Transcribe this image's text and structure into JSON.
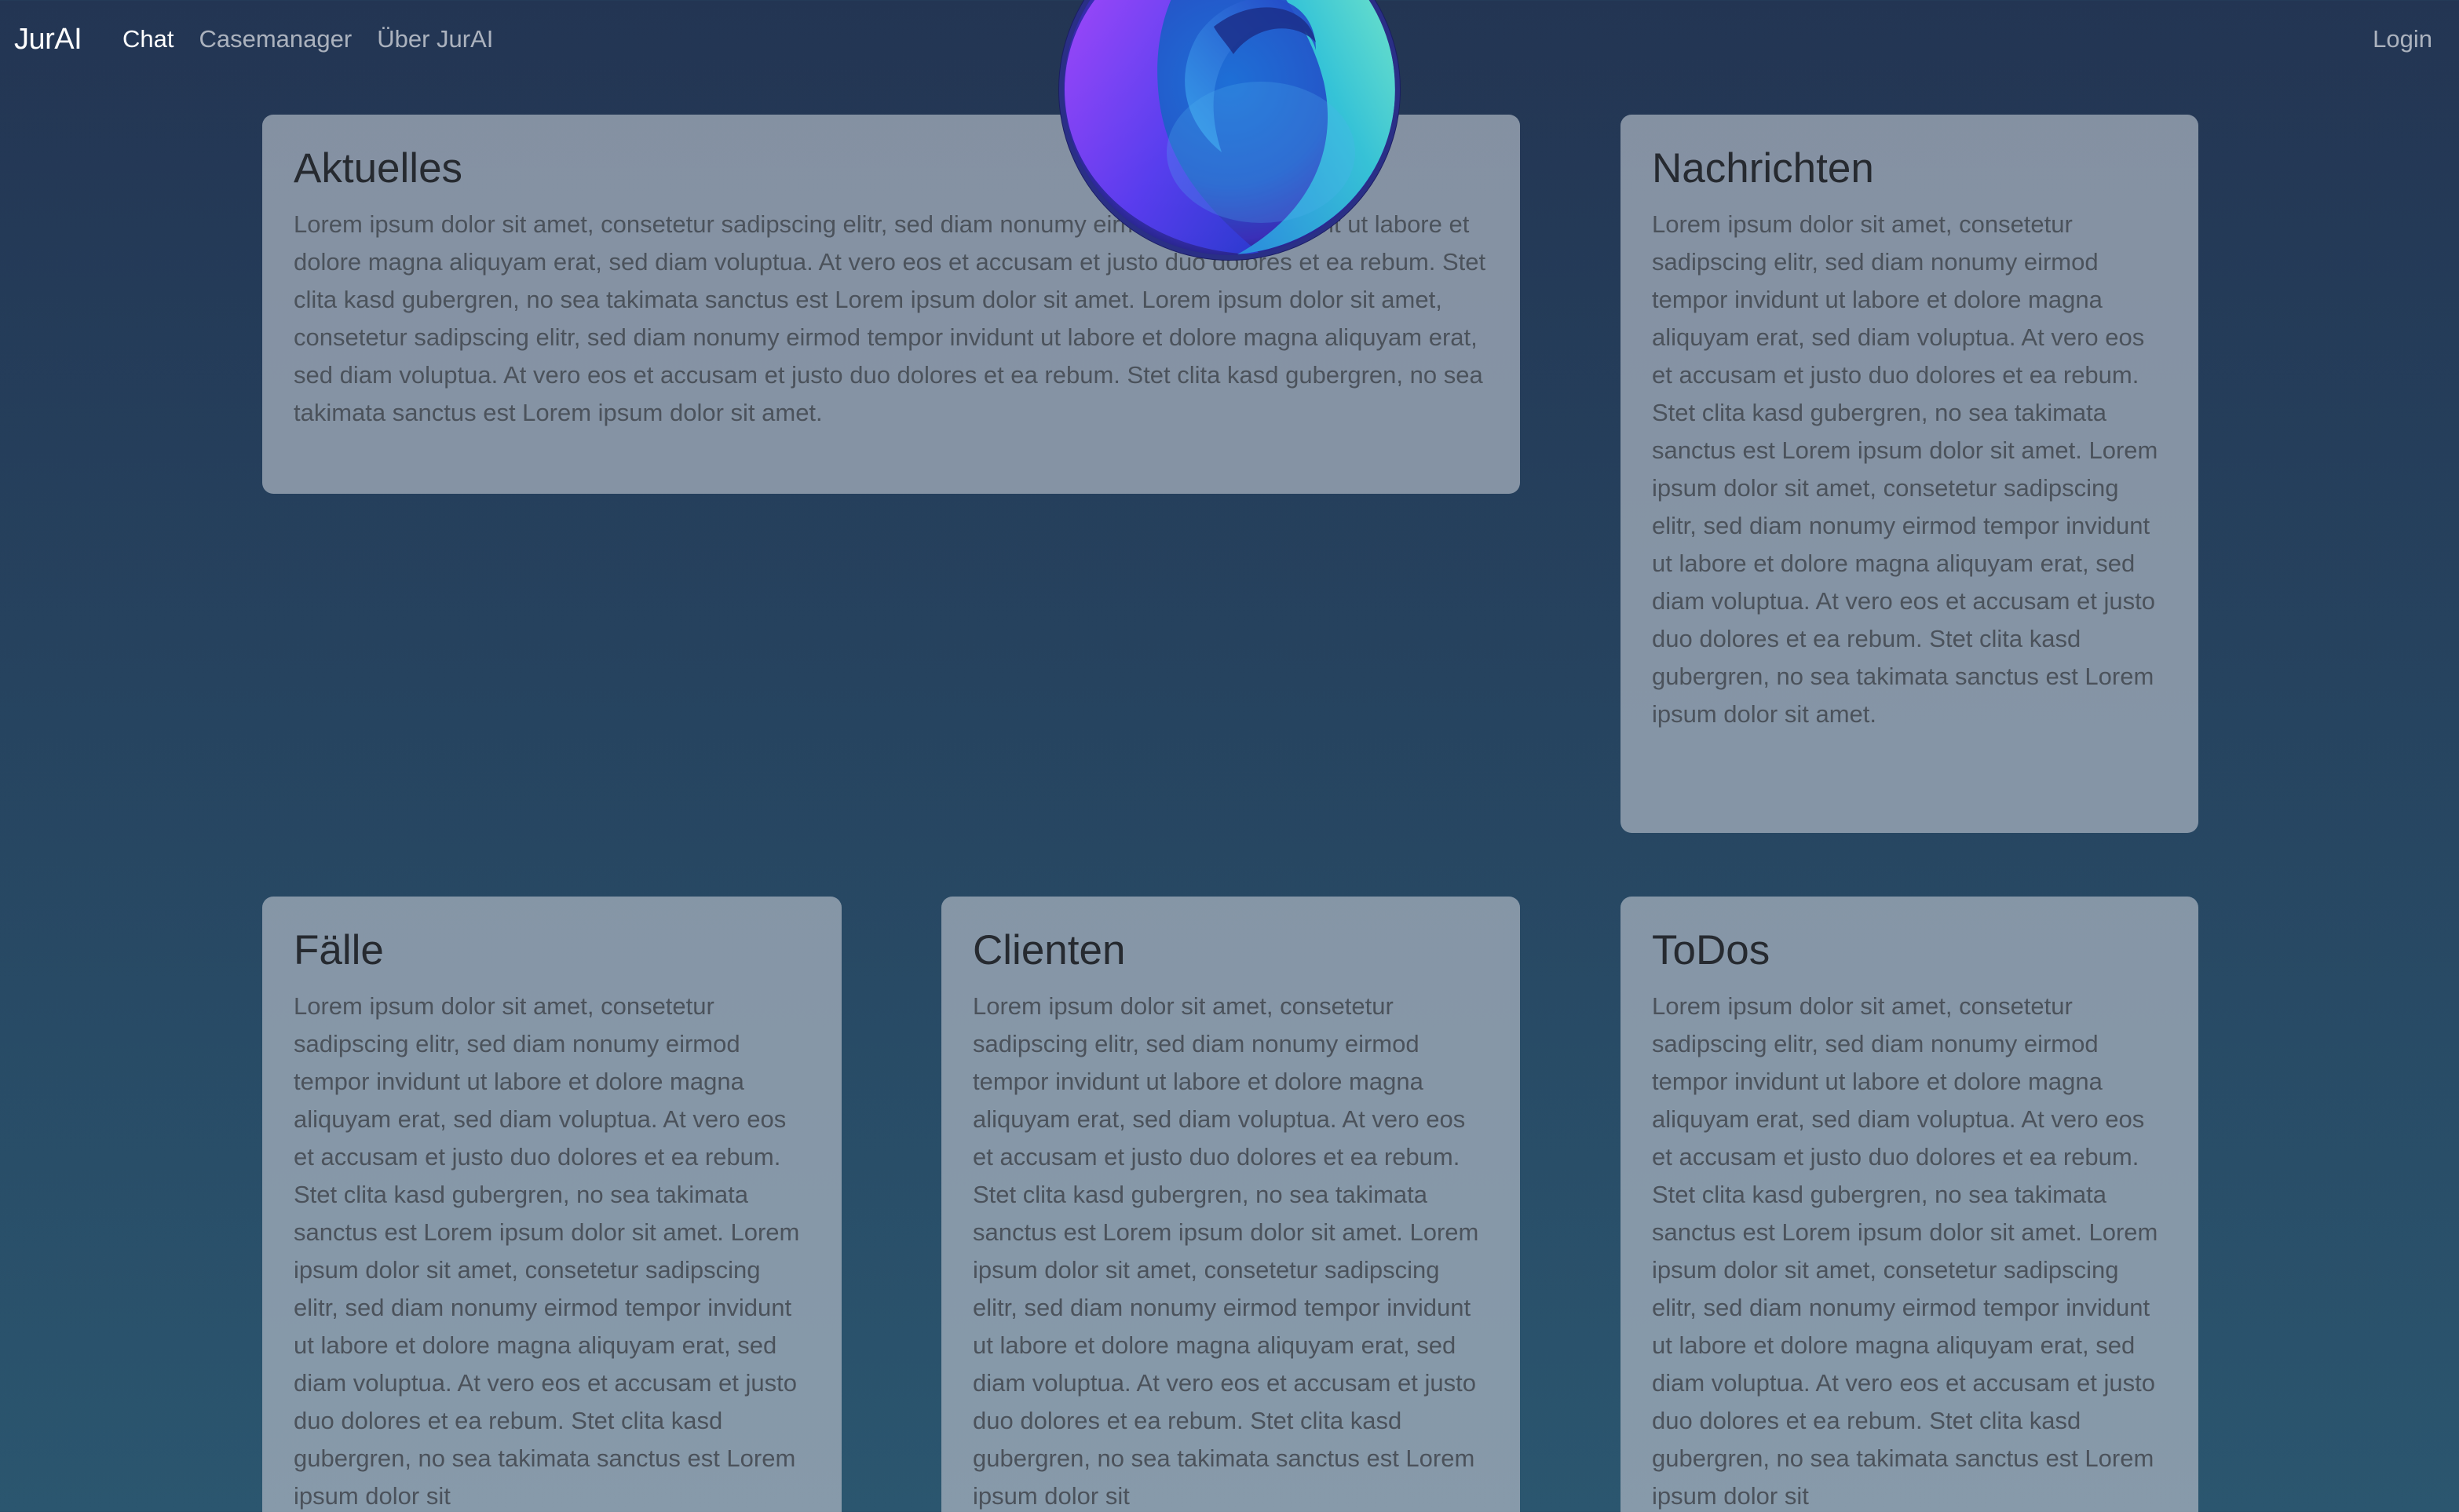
{
  "nav": {
    "brand": "JurAI",
    "links": [
      {
        "label": "Chat",
        "active": true
      },
      {
        "label": "Casemanager",
        "active": false
      },
      {
        "label": "Über JurAI",
        "active": false
      }
    ],
    "login": "Login"
  },
  "logo": {
    "icon": "orb-logo-icon"
  },
  "cards": {
    "aktuelles": {
      "title": "Aktuelles",
      "text": "Lorem ipsum dolor sit amet, consetetur sadipscing elitr, sed diam nonumy eirmod tempor invidunt ut labore et dolore magna aliquyam erat, sed diam voluptua. At vero eos et accusam et justo duo dolores et ea rebum. Stet clita kasd gubergren, no sea takimata sanctus est Lorem ipsum dolor sit amet. Lorem ipsum dolor sit amet, consetetur sadipscing elitr, sed diam nonumy eirmod tempor invidunt ut labore et dolore magna aliquyam erat, sed diam voluptua. At vero eos et accusam et justo duo dolores et ea rebum. Stet clita kasd gubergren, no sea takimata sanctus est Lorem ipsum dolor sit amet."
    },
    "nachrichten": {
      "title": "Nachrichten",
      "text": "Lorem ipsum dolor sit amet, consetetur sadipscing elitr, sed diam nonumy eirmod tempor invidunt ut labore et dolore magna aliquyam erat, sed diam voluptua. At vero eos et accusam et justo duo dolores et ea rebum. Stet clita kasd gubergren, no sea takimata sanctus est Lorem ipsum dolor sit amet. Lorem ipsum dolor sit amet, consetetur sadipscing elitr, sed diam nonumy eirmod tempor invidunt ut labore et dolore magna aliquyam erat, sed diam voluptua. At vero eos et accusam et justo duo dolores et ea rebum. Stet clita kasd gubergren, no sea takimata sanctus est Lorem ipsum dolor sit amet."
    },
    "faelle": {
      "title": "Fälle",
      "text": "Lorem ipsum dolor sit amet, consetetur sadipscing elitr, sed diam nonumy eirmod tempor invidunt ut labore et dolore magna aliquyam erat, sed diam voluptua. At vero eos et accusam et justo duo dolores et ea rebum. Stet clita kasd gubergren, no sea takimata sanctus est Lorem ipsum dolor sit amet. Lorem ipsum dolor sit amet, consetetur sadipscing elitr, sed diam nonumy eirmod tempor invidunt ut labore et dolore magna aliquyam erat, sed diam voluptua. At vero eos et accusam et justo duo dolores et ea rebum. Stet clita kasd gubergren, no sea takimata sanctus est Lorem ipsum dolor sit"
    },
    "clienten": {
      "title": "Clienten",
      "text": "Lorem ipsum dolor sit amet, consetetur sadipscing elitr, sed diam nonumy eirmod tempor invidunt ut labore et dolore magna aliquyam erat, sed diam voluptua. At vero eos et accusam et justo duo dolores et ea rebum. Stet clita kasd gubergren, no sea takimata sanctus est Lorem ipsum dolor sit amet. Lorem ipsum dolor sit amet, consetetur sadipscing elitr, sed diam nonumy eirmod tempor invidunt ut labore et dolore magna aliquyam erat, sed diam voluptua. At vero eos et accusam et justo duo dolores et ea rebum. Stet clita kasd gubergren, no sea takimata sanctus est Lorem ipsum dolor sit"
    },
    "todos": {
      "title": "ToDos",
      "text": "Lorem ipsum dolor sit amet, consetetur sadipscing elitr, sed diam nonumy eirmod tempor invidunt ut labore et dolore magna aliquyam erat, sed diam voluptua. At vero eos et accusam et justo duo dolores et ea rebum. Stet clita kasd gubergren, no sea takimata sanctus est Lorem ipsum dolor sit amet. Lorem ipsum dolor sit amet, consetetur sadipscing elitr, sed diam nonumy eirmod tempor invidunt ut labore et dolore magna aliquyam erat, sed diam voluptua. At vero eos et accusam et justo duo dolores et ea rebum. Stet clita kasd gubergren, no sea takimata sanctus est Lorem ipsum dolor sit"
    }
  }
}
